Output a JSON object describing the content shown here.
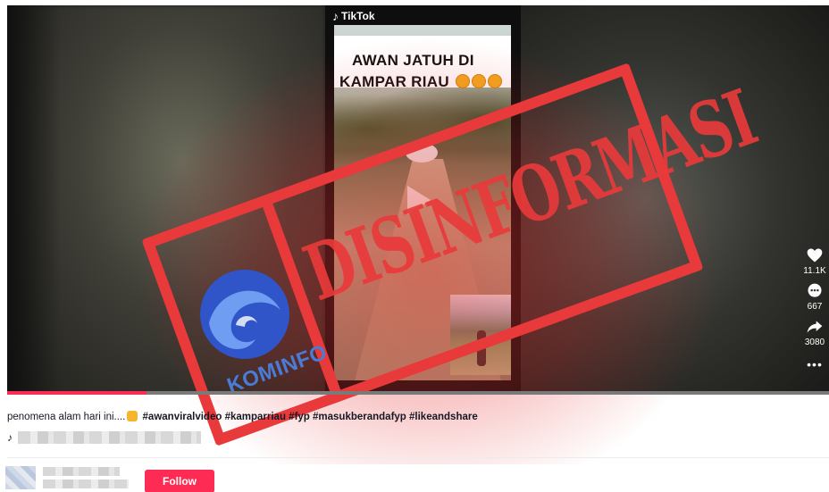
{
  "video": {
    "brand": "TikTok",
    "caption_line1": "AWAN JATUH DI",
    "caption_line2": "KAMPAR RIAU",
    "progress_percent": 17
  },
  "stamp": {
    "text": "DISINFORMASI",
    "logo_text": "KOMINFO",
    "color": "#e8393b"
  },
  "actions": {
    "likes": "11.1K",
    "comments": "667",
    "shares": "3080"
  },
  "post": {
    "description": "penomena alam hari ini....",
    "hashtags": "#awanviralvideo #kamparriau #fyp #masukberandafyp #likeandshare",
    "music_symbol": "♪"
  },
  "author": {
    "follow_label": "Follow"
  },
  "colors": {
    "accent": "#fe2c55"
  }
}
